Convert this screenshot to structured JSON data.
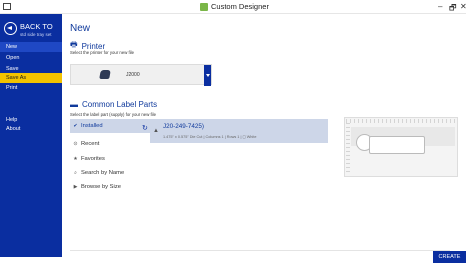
{
  "window": {
    "title": "Custom Designer",
    "controls": [
      "–",
      "🗗",
      "✕"
    ]
  },
  "sidebar": {
    "back_label": "BACK TO",
    "back_sub": "std side tray set",
    "items": [
      {
        "label": "New",
        "state": "active"
      },
      {
        "label": "Open",
        "state": ""
      },
      {
        "label": "Save",
        "state": ""
      },
      {
        "label": "Save As",
        "state": "highlight"
      },
      {
        "label": "Print",
        "state": ""
      },
      {
        "label": "Help",
        "state": ""
      },
      {
        "label": "About",
        "state": ""
      }
    ]
  },
  "main": {
    "title": "New",
    "printer_section": {
      "heading": "Printer",
      "subtitle": "Select the printer for your new file",
      "printer_name": "J2000"
    },
    "label_section": {
      "heading": "Common Label Parts",
      "subtitle": "Select the label part (supply) for your new file"
    },
    "filters": [
      {
        "label": "Installed",
        "icon": "✔",
        "selected": true
      },
      {
        "label": "Recent",
        "icon": "⊙",
        "selected": false
      },
      {
        "label": "Favorites",
        "icon": "★",
        "selected": false
      },
      {
        "label": "Search by Name",
        "icon": "⌕",
        "selected": false
      },
      {
        "label": "Browse by Size",
        "icon": "▶",
        "selected": false
      }
    ],
    "result": {
      "title": "J20-249-7425)",
      "meta": "1.475\" x 0.575\" Die Cut | Columns 1 | Rows 1 | ◻ White"
    },
    "create_label": "CREATE"
  },
  "colors": {
    "sidebar": "#0a2ea0",
    "highlight": "#f3c300",
    "accent_text": "#103a9c",
    "selected_bg": "#cdd6e8"
  }
}
